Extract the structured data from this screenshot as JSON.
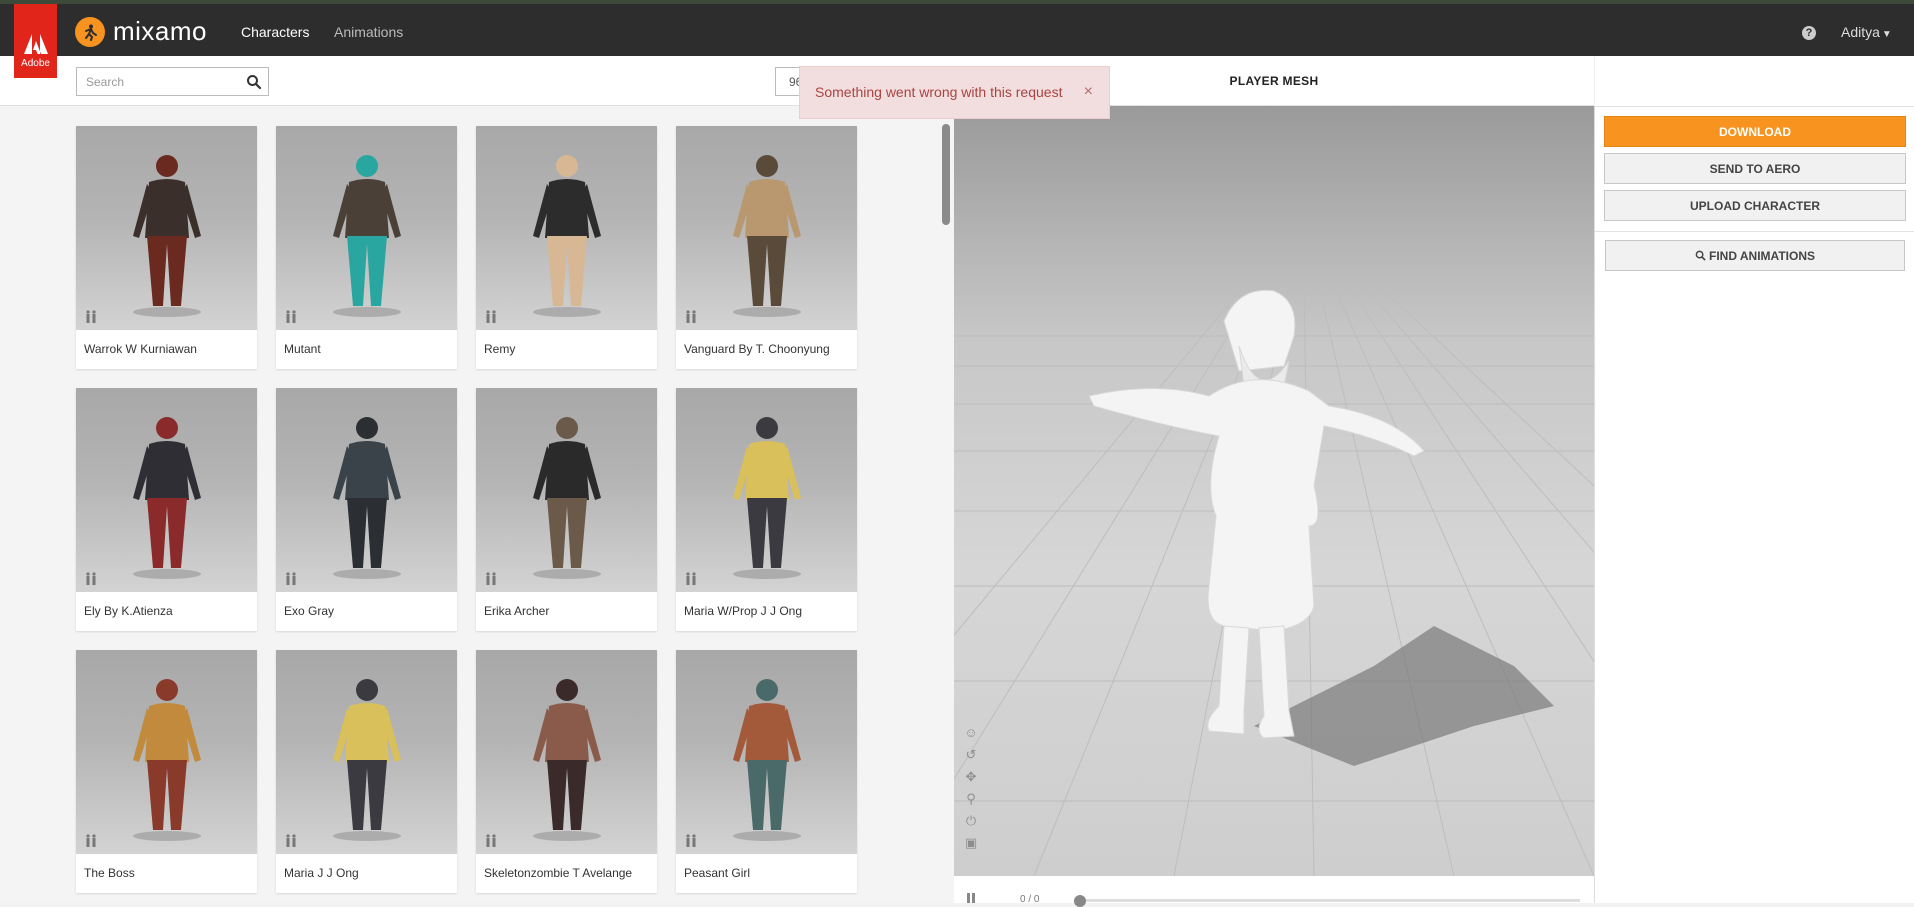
{
  "brand": {
    "adobe_label": "Adobe",
    "name": "mixamo"
  },
  "nav": {
    "tabs": [
      {
        "label": "Characters",
        "active": true
      },
      {
        "label": "Animations",
        "active": false
      }
    ]
  },
  "header_right": {
    "help_glyph": "?",
    "user": "Aditya"
  },
  "search": {
    "placeholder": "Search",
    "value": ""
  },
  "page_select": {
    "value": "96"
  },
  "toast": {
    "message": "Something went wrong with this request",
    "close_glyph": "×"
  },
  "characters": [
    {
      "name": "Warrok W Kurniawan",
      "color": "#3a2f2a",
      "accent": "#6a2a20"
    },
    {
      "name": "Mutant",
      "color": "#4a4038",
      "accent": "#2aa6a0"
    },
    {
      "name": "Remy",
      "color": "#2c2c2c",
      "accent": "#d8b894"
    },
    {
      "name": "Vanguard By T. Choonyung",
      "color": "#b9986f",
      "accent": "#5a4a3a"
    },
    {
      "name": "Ely By K.Atienza",
      "color": "#2e2e34",
      "accent": "#8a2a2a"
    },
    {
      "name": "Exo Gray",
      "color": "#3a434a",
      "accent": "#2b2f33"
    },
    {
      "name": "Erika Archer",
      "color": "#2a2a2a",
      "accent": "#6b5a4a"
    },
    {
      "name": "Maria W/Prop J J Ong",
      "color": "#d9c05a",
      "accent": "#3a3a40"
    },
    {
      "name": "The Boss",
      "color": "#c28a3c",
      "accent": "#8a3a2a"
    },
    {
      "name": "Maria J J Ong",
      "color": "#d9c05a",
      "accent": "#3a3a40"
    },
    {
      "name": "Skeletonzombie T Avelange",
      "color": "#8a5a4a",
      "accent": "#3a2a2a"
    },
    {
      "name": "Peasant Girl",
      "color": "#a25a3a",
      "accent": "#4a6a6a"
    }
  ],
  "viewer": {
    "title": "PLAYER MESH",
    "frame_count": "0 / 0"
  },
  "actions": {
    "download": "DOWNLOAD",
    "send_to_aero": "SEND TO AERO",
    "upload_character": "UPLOAD CHARACTER",
    "find_animations": "FIND ANIMATIONS"
  },
  "colors": {
    "accent": "#f7931e",
    "topbar": "#2d2d2d",
    "adobe_red": "#e1251b",
    "error_bg": "#f2dede",
    "error_text": "#a94442"
  }
}
